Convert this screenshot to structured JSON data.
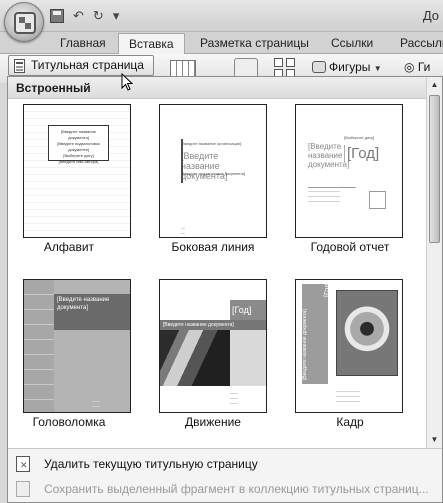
{
  "qat": {
    "undo": "↶",
    "redo": "↷",
    "refresh": "↻",
    "more": "▾"
  },
  "title_text": "До",
  "tabs": [
    "Главная",
    "Вставка",
    "Разметка страницы",
    "Ссылки",
    "Рассылк"
  ],
  "ribbon": {
    "cover_page_label": "Титульная страница",
    "shapes_label": "Фигуры",
    "right_label": "Ги"
  },
  "panel": {
    "section_header": "Встроенный",
    "items": [
      {
        "label": "Алфавит",
        "placeholder_title": "[Введите название документа]",
        "placeholder_sub": "[Введите подзаголовок документа]",
        "placeholder_year": "[Выберите дату]",
        "placeholder_author": "[Введите имя автора]"
      },
      {
        "label": "Боковая линия",
        "placeholder_title": "[Введите название документа]",
        "placeholder_sub": "[Введите подзаголовок документа]",
        "placeholder_org": "[Введите название организации]"
      },
      {
        "label": "Годовой отчет",
        "placeholder_title": "[Введите название документа]",
        "placeholder_year": "[Год]",
        "placeholder_date": "[Выберите дату]"
      },
      {
        "label": "Головоломка",
        "placeholder_title": "[Введите название документа]"
      },
      {
        "label": "Движение",
        "placeholder_title": "[Введите название документа]",
        "placeholder_year": "[Год]"
      },
      {
        "label": "Кадр",
        "placeholder_title": "[Введите название документа]",
        "placeholder_year": "[Год]"
      }
    ],
    "menu": [
      {
        "label": "Удалить текущую титульную страницу"
      },
      {
        "label": "Сохранить выделенный фрагмент в коллекцию титульных страниц..."
      }
    ]
  }
}
